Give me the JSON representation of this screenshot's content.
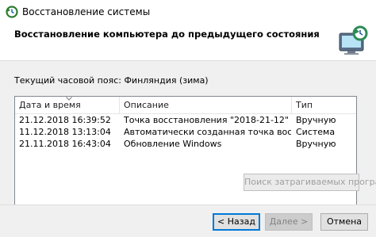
{
  "window": {
    "title": "Восстановление системы"
  },
  "header": {
    "heading": "Восстановление компьютера до предыдущего состояния"
  },
  "timezone": {
    "label": "Текущий часовой пояс: Финляндия (зима)"
  },
  "restore_points": {
    "columns": [
      "Дата и время",
      "Описание",
      "Тип"
    ],
    "rows": [
      {
        "date": "21.12.2018 16:39:52",
        "description": "Точка восстановления \"2018-21-12\"",
        "type": "Вручную"
      },
      {
        "date": "11.12.2018 13:13:04",
        "description": "Автоматически созданная точка восстановления",
        "type": "Система"
      },
      {
        "date": "21.11.2018 16:43:04",
        "description": "Обновление Windows",
        "type": "Вручную"
      }
    ]
  },
  "buttons": {
    "scan": "Поиск затрагиваемых программ",
    "back": "< Назад",
    "next": "Далее >",
    "cancel": "Отмена"
  },
  "colors": {
    "focus_border": "#0078d7",
    "content_bg": "#f0f0f0"
  },
  "icons": {
    "title": "system-restore-icon",
    "header": "monitor-restore-icon"
  }
}
